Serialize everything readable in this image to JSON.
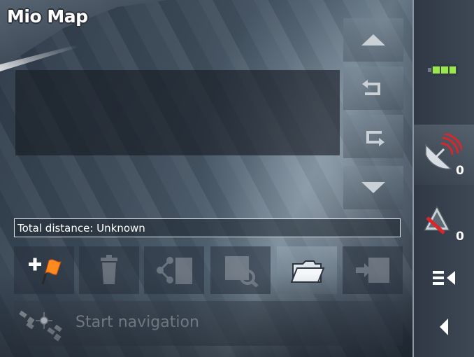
{
  "window": {
    "title": "Mio Map"
  },
  "route_list": {
    "items": []
  },
  "nav_buttons": [
    {
      "name": "scroll-up",
      "icon": "triangle-up-icon",
      "enabled": true
    },
    {
      "name": "undo",
      "icon": "undo-arrow-icon",
      "enabled": true
    },
    {
      "name": "redo",
      "icon": "redo-arrow-icon",
      "enabled": true
    },
    {
      "name": "scroll-down",
      "icon": "triangle-down-icon",
      "enabled": true
    }
  ],
  "status": {
    "total_distance": "Total distance: Unknown"
  },
  "toolbar": [
    {
      "name": "add-waypoint",
      "icon": "plus-flag-icon",
      "enabled": true
    },
    {
      "name": "delete",
      "icon": "trash-icon",
      "enabled": false
    },
    {
      "name": "route-calculator",
      "icon": "route-calculator-icon",
      "enabled": false
    },
    {
      "name": "map-search",
      "icon": "map-magnifier-icon",
      "enabled": false
    },
    {
      "name": "open-folder",
      "icon": "folder-open-icon",
      "enabled": true,
      "active": true
    },
    {
      "name": "export",
      "icon": "export-icon",
      "enabled": false
    }
  ],
  "navigation": {
    "start_label": "Start navigation",
    "icon": "satellite-gps-icon"
  },
  "sidebar": {
    "battery": {
      "icon": "battery-icon",
      "color": "#9be84a"
    },
    "satellites": {
      "icon": "satellite-dish-icon",
      "count": "0",
      "signal_color": "#d8262a"
    },
    "alerts": {
      "icon": "warning-cross-icon",
      "count": "0"
    },
    "menu": {
      "icon": "menu-collapse-icon"
    },
    "back": {
      "icon": "back-arrow-icon"
    }
  }
}
